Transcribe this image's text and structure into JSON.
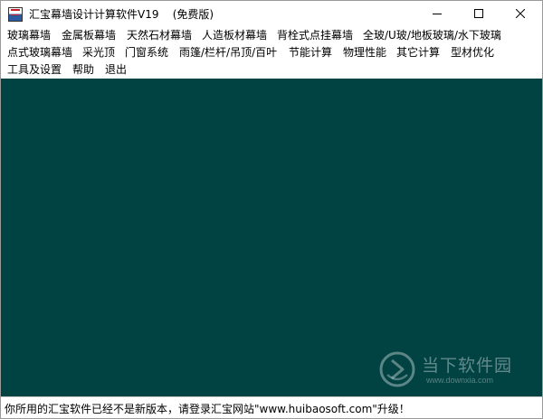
{
  "window": {
    "title": "汇宝幕墙设计计算软件V19    (免费版)"
  },
  "menubar": {
    "items": [
      "玻璃幕墙",
      "金属板幕墙",
      "天然石材幕墙",
      "人造板材幕墙",
      "背栓式点挂幕墙",
      "全玻/U玻/地板玻璃/水下玻璃",
      "点式玻璃幕墙",
      "采光顶",
      "门窗系统",
      "雨篷/栏杆/吊顶/百叶",
      "节能计算",
      "物理性能",
      "其它计算",
      "型材优化",
      "工具及设置",
      "帮助",
      "退出"
    ]
  },
  "client": {
    "background_color": "#014243"
  },
  "watermark": {
    "title": "当下软件园",
    "url": "www.downxia.com"
  },
  "statusbar": {
    "text": "你所用的汇宝软件已经不是新版本，请登录汇宝网站\"www.huibaosoft.com\"升级！"
  }
}
